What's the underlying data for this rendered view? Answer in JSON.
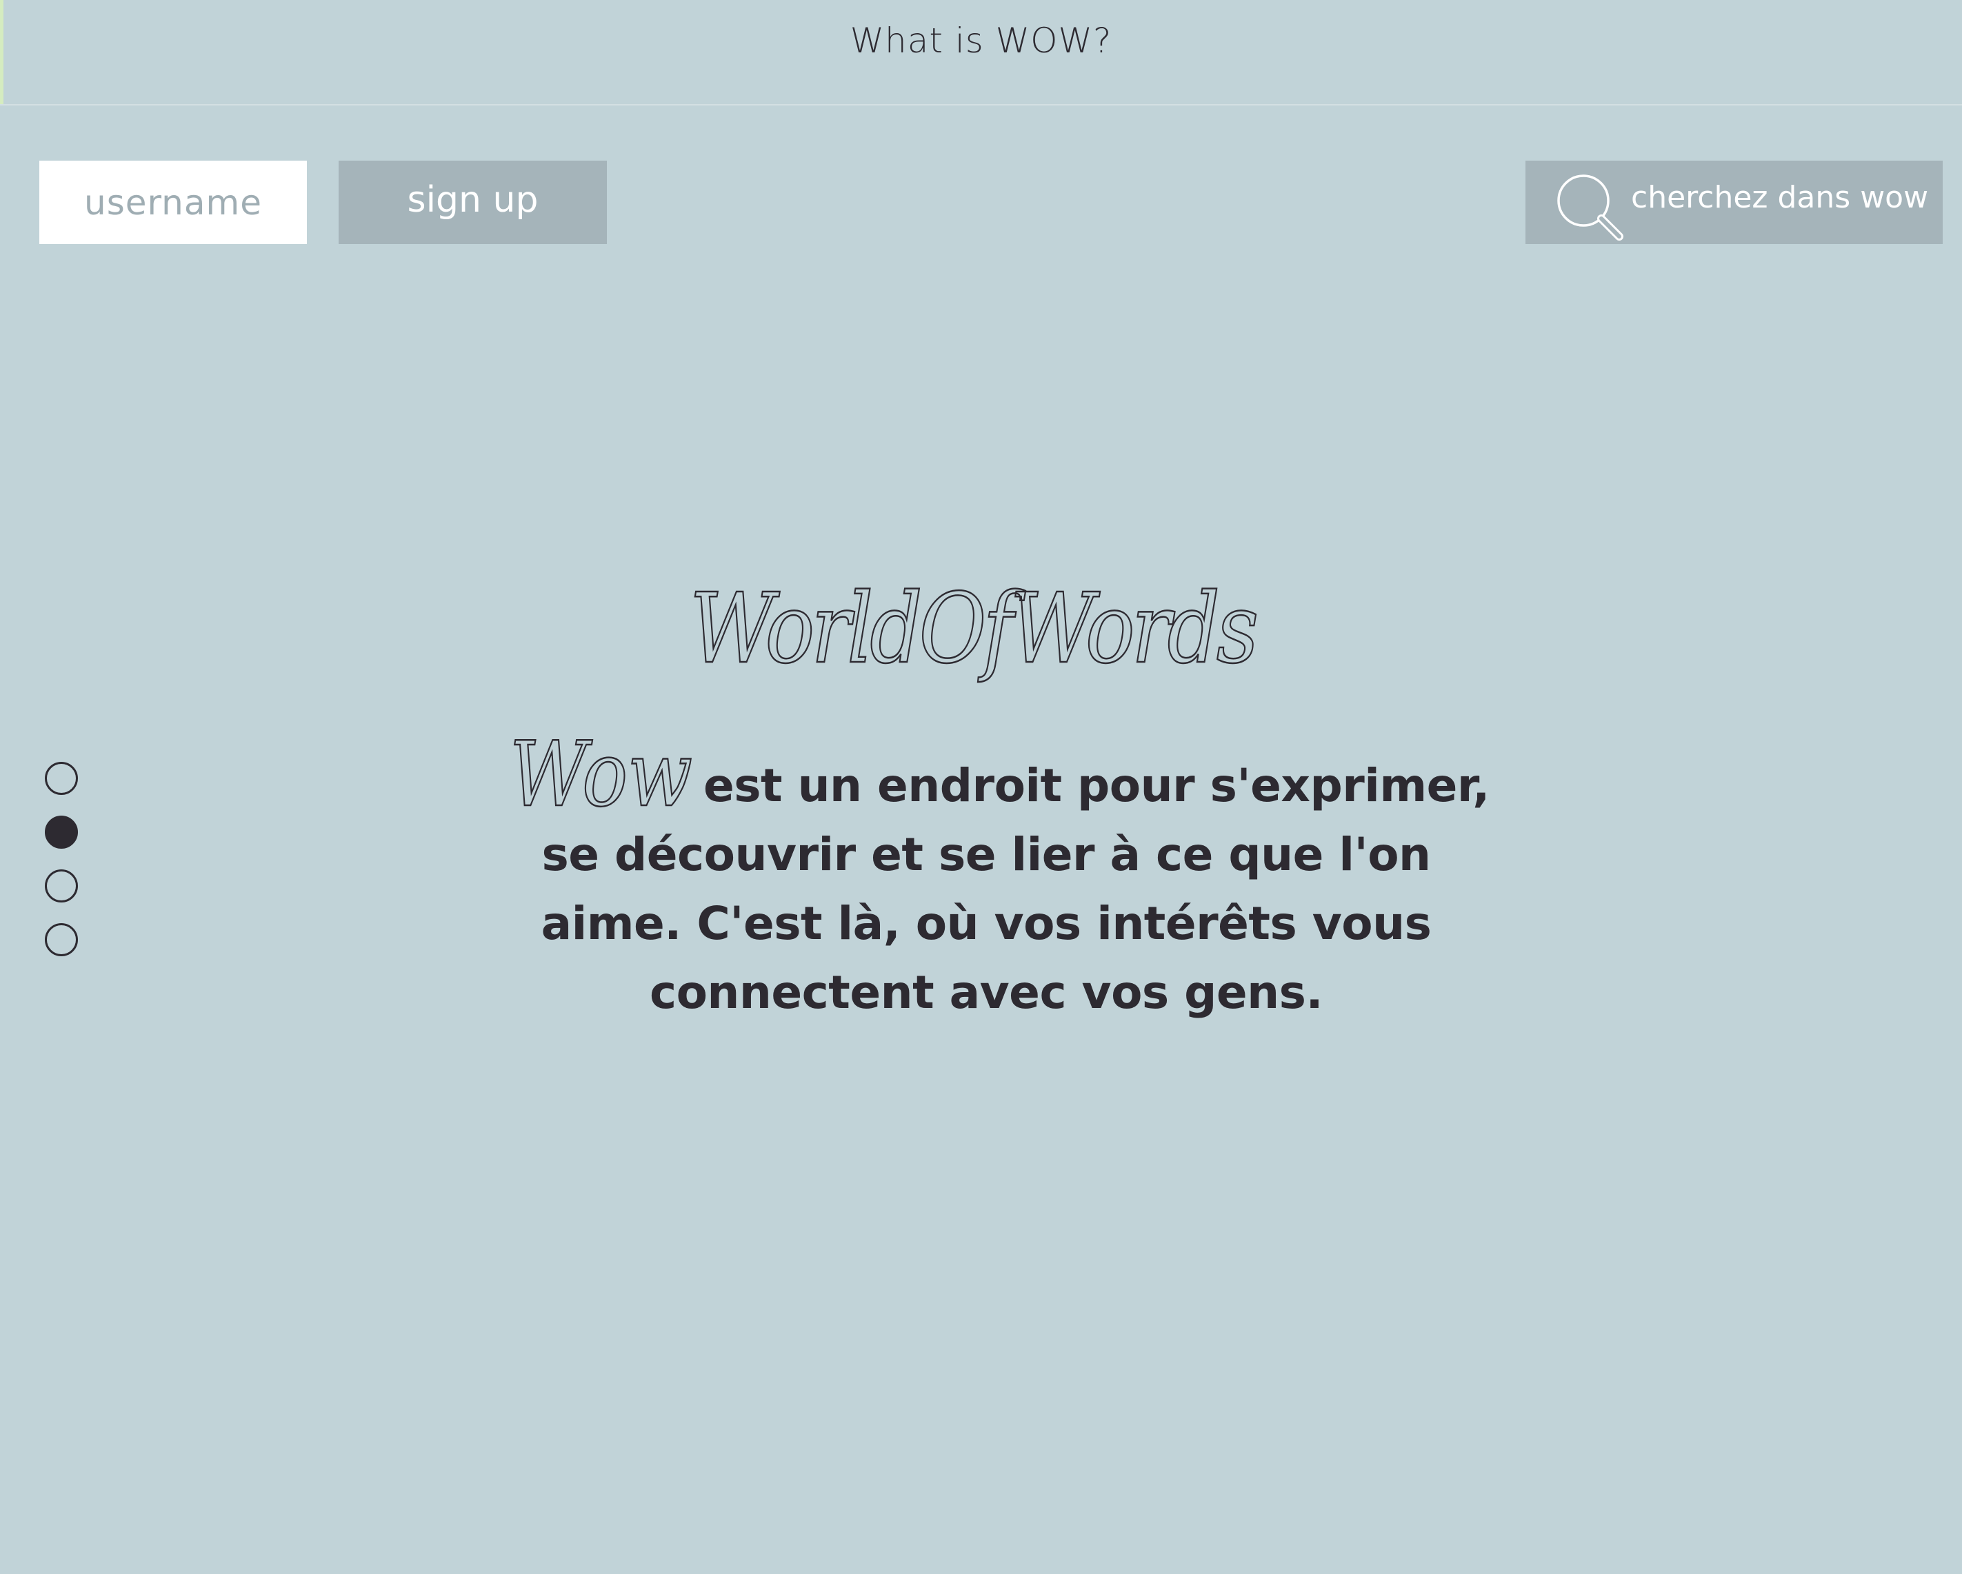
{
  "header": {
    "title": "What is WOW?"
  },
  "auth": {
    "username_placeholder": "username",
    "signup_label": "sign up"
  },
  "search": {
    "label": "cherchez dans wow",
    "icon": "search-icon"
  },
  "hero": {
    "logo_text": "WorldOfWords",
    "wow_script": "Wow",
    "description_lines": [
      "est un endroit pour s'exprimer,",
      "se découvrir et se lier à ce que l'on",
      "aime. C'est là, où vos intérêts vous",
      "connectent avec vos gens."
    ]
  },
  "pagination": {
    "total": 4,
    "active_index": 1
  },
  "colors": {
    "background": "#c1d3d8",
    "text_dark": "#2d2a31",
    "button_gray": "#a5b4ba",
    "accent_green": "#d5ecc0"
  }
}
